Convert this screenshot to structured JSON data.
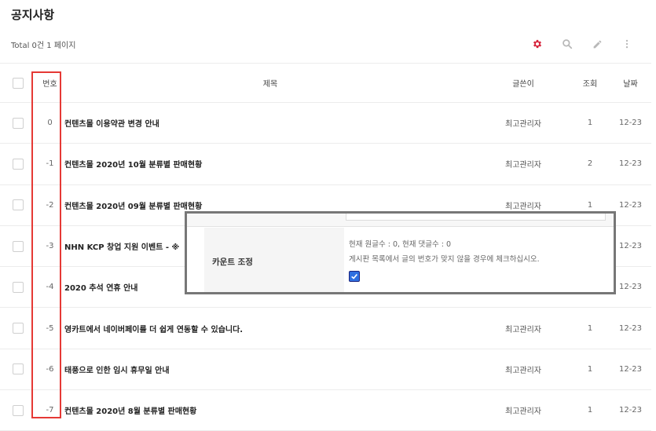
{
  "page": {
    "title": "공지사항",
    "total": "Total 0건 1 페이지"
  },
  "toolbar": [
    {
      "icon": "gear-icon",
      "color": "#d7263d"
    },
    {
      "icon": "search-icon",
      "color": "#b8b8b8"
    },
    {
      "icon": "pencil-icon",
      "color": "#b8b8b8"
    },
    {
      "icon": "more-vertical-icon",
      "color": "#b8b8b8"
    }
  ],
  "table": {
    "headers": {
      "num": "번호",
      "subject": "제목",
      "writer": "글쓴이",
      "hit": "조회",
      "date": "날짜"
    },
    "rows": [
      {
        "num": "0",
        "subject": "컨텐츠몰 이용약관 변경 안내",
        "writer": "최고관리자",
        "hit": "1",
        "date": "12-23"
      },
      {
        "num": "-1",
        "subject": "컨텐츠몰 2020년 10월 분류별 판매현황",
        "writer": "최고관리자",
        "hit": "2",
        "date": "12-23"
      },
      {
        "num": "-2",
        "subject": "컨텐츠몰 2020년 09월 분류별 판매현황",
        "writer": "최고관리자",
        "hit": "1",
        "date": "12-23"
      },
      {
        "num": "-3",
        "subject": "NHN KCP 창업 지원 이벤트 - ※",
        "writer": "",
        "hit": "",
        "date": "12-23"
      },
      {
        "num": "-4",
        "subject": "2020 추석 연휴 안내",
        "writer": "",
        "hit": "",
        "date": "12-23"
      },
      {
        "num": "-5",
        "subject": "영카트에서 네이버페이를 더 쉽게 연동할 수 있습니다.",
        "writer": "최고관리자",
        "hit": "1",
        "date": "12-23"
      },
      {
        "num": "-6",
        "subject": "태풍으로 인한 임시 휴무일 안내",
        "writer": "최고관리자",
        "hit": "1",
        "date": "12-23"
      },
      {
        "num": "-7",
        "subject": "컨텐츠몰 2020년 8월 분류별 판매현황",
        "writer": "최고관리자",
        "hit": "1",
        "date": "12-23"
      }
    ]
  },
  "popup": {
    "label": "카운트 조정",
    "line1": "현재 원글수 : 0, 현재 댓글수 : 0",
    "line2": "게시판 목록에서 글의 번호가 맞지 않을 경우에 체크하십시오.",
    "checked": true
  }
}
